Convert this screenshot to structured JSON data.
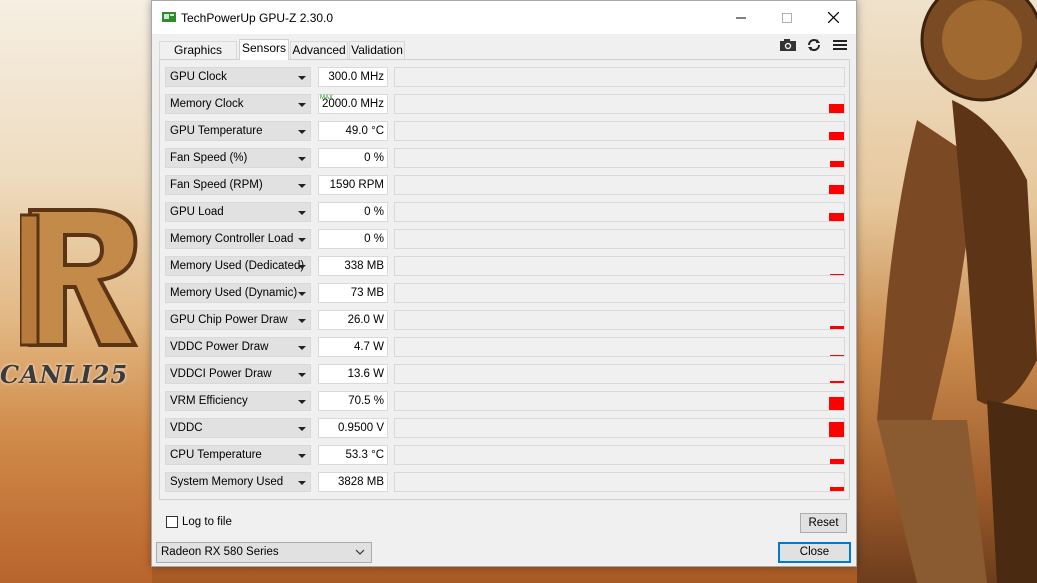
{
  "window": {
    "title": "TechPowerUp GPU-Z 2.30.0",
    "app_icon": "gpu-card-icon",
    "controls": [
      "minimize-icon",
      "maximize-icon",
      "close-icon"
    ]
  },
  "tabs": [
    {
      "label": "Graphics Card",
      "active": false
    },
    {
      "label": "Sensors",
      "active": true
    },
    {
      "label": "Advanced",
      "active": false
    },
    {
      "label": "Validation",
      "active": false
    }
  ],
  "toolbar": {
    "icons": [
      "camera-icon",
      "refresh-icon",
      "menu-icon"
    ]
  },
  "sensors": [
    {
      "name": "GPU Clock",
      "value": "300.0 MHz",
      "max_tag": "",
      "activity": 0
    },
    {
      "name": "Memory Clock",
      "value": "2000.0 MHz",
      "max_tag": "MAX",
      "activity": 0.5
    },
    {
      "name": "GPU Temperature",
      "value": "49.0 °C",
      "max_tag": "",
      "activity": 0.45
    },
    {
      "name": "Fan Speed (%)",
      "value": "0 %",
      "max_tag": "",
      "activity": 0.35
    },
    {
      "name": "Fan Speed (RPM)",
      "value": "1590 RPM",
      "max_tag": "",
      "activity": 0.5
    },
    {
      "name": "GPU Load",
      "value": "0 %",
      "max_tag": "",
      "activity": 0.45
    },
    {
      "name": "Memory Controller Load",
      "value": "0 %",
      "max_tag": "",
      "activity": 0
    },
    {
      "name": "Memory Used (Dedicated)",
      "value": "338 MB",
      "max_tag": "",
      "activity": 0.05
    },
    {
      "name": "Memory Used (Dynamic)",
      "value": "73 MB",
      "max_tag": "",
      "activity": 0
    },
    {
      "name": "GPU Chip Power Draw",
      "value": "26.0 W",
      "max_tag": "",
      "activity": 0.15
    },
    {
      "name": "VDDC Power Draw",
      "value": "4.7 W",
      "max_tag": "",
      "activity": 0.05
    },
    {
      "name": "VDDCI Power Draw",
      "value": "13.6 W",
      "max_tag": "",
      "activity": 0.1
    },
    {
      "name": "VRM Efficiency",
      "value": "70.5 %",
      "max_tag": "",
      "activity": 0.7
    },
    {
      "name": "VDDC",
      "value": "0.9500 V",
      "max_tag": "",
      "activity": 0.85
    },
    {
      "name": "CPU Temperature",
      "value": "53.3 °C",
      "max_tag": "",
      "activity": 0.25
    },
    {
      "name": "System Memory Used",
      "value": "3828 MB",
      "max_tag": "",
      "activity": 0.2
    }
  ],
  "bottom": {
    "log_label": "Log to file",
    "log_checked": false,
    "reset_label": "Reset",
    "gpu_selected": "Radeon RX 580 Series",
    "close_label": "Close"
  },
  "desktop": {
    "brand_text": "CANLI25"
  },
  "colors": {
    "graph": "#ff0000",
    "accent": "#0078d7",
    "max_tag": "#1a8a1a"
  }
}
